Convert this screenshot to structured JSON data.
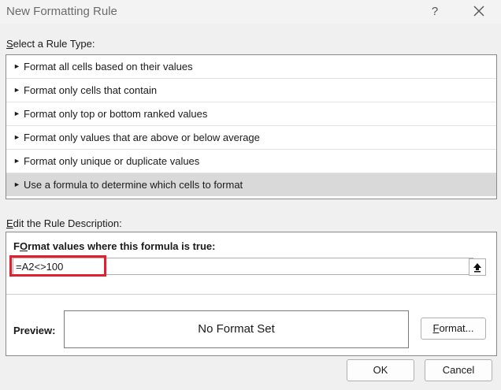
{
  "window": {
    "title": "New Formatting Rule",
    "help_glyph": "?"
  },
  "rule_type": {
    "label": "Select a Rule Type:",
    "label_underline_char": "S",
    "label_rest": "elect a Rule Type:",
    "items": [
      {
        "label": "Format all cells based on their values",
        "selected": false
      },
      {
        "label": "Format only cells that contain",
        "selected": false
      },
      {
        "label": "Format only top or bottom ranked values",
        "selected": false
      },
      {
        "label": "Format only values that are above or below average",
        "selected": false
      },
      {
        "label": "Format only unique or duplicate values",
        "selected": false
      },
      {
        "label": "Use a formula to determine which cells to format",
        "selected": true
      }
    ]
  },
  "description": {
    "label_underline_char": "E",
    "label_rest": "dit the Rule Description:",
    "formula_label_underline_char": "O",
    "formula_label_prefix": "F",
    "formula_label_rest": "rmat values where this formula is true:",
    "formula_value": "=A2<>100",
    "preview_label": "Preview:",
    "preview_text": "No Format Set",
    "format_button_underline_char": "F",
    "format_button_rest": "ormat..."
  },
  "buttons": {
    "ok": "OK",
    "cancel": "Cancel"
  },
  "colors": {
    "highlight": "#e0202f",
    "selected_row": "#d9d9d9"
  }
}
